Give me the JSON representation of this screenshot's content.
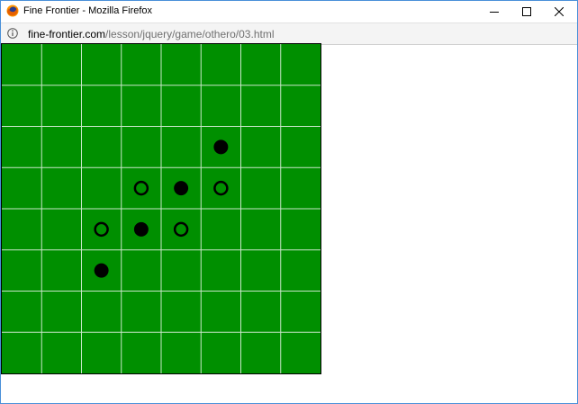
{
  "window": {
    "title": "Fine Frontier - Mozilla Firefox",
    "icon": "firefox-icon"
  },
  "address_bar": {
    "icon": "info-icon",
    "domain": "fine-frontier.com",
    "path": "/lesson/jquery/game/othero/03.html"
  },
  "board": {
    "rows": 8,
    "cols": 8,
    "colors": {
      "board": "#008f00",
      "grid": "#c8e6c8",
      "stone": "#000000"
    },
    "black_stones": [
      [
        2,
        5
      ],
      [
        3,
        4
      ],
      [
        4,
        3
      ],
      [
        5,
        2
      ]
    ],
    "white_stones": [
      [
        3,
        3
      ],
      [
        3,
        5
      ],
      [
        4,
        2
      ],
      [
        4,
        4
      ]
    ]
  }
}
